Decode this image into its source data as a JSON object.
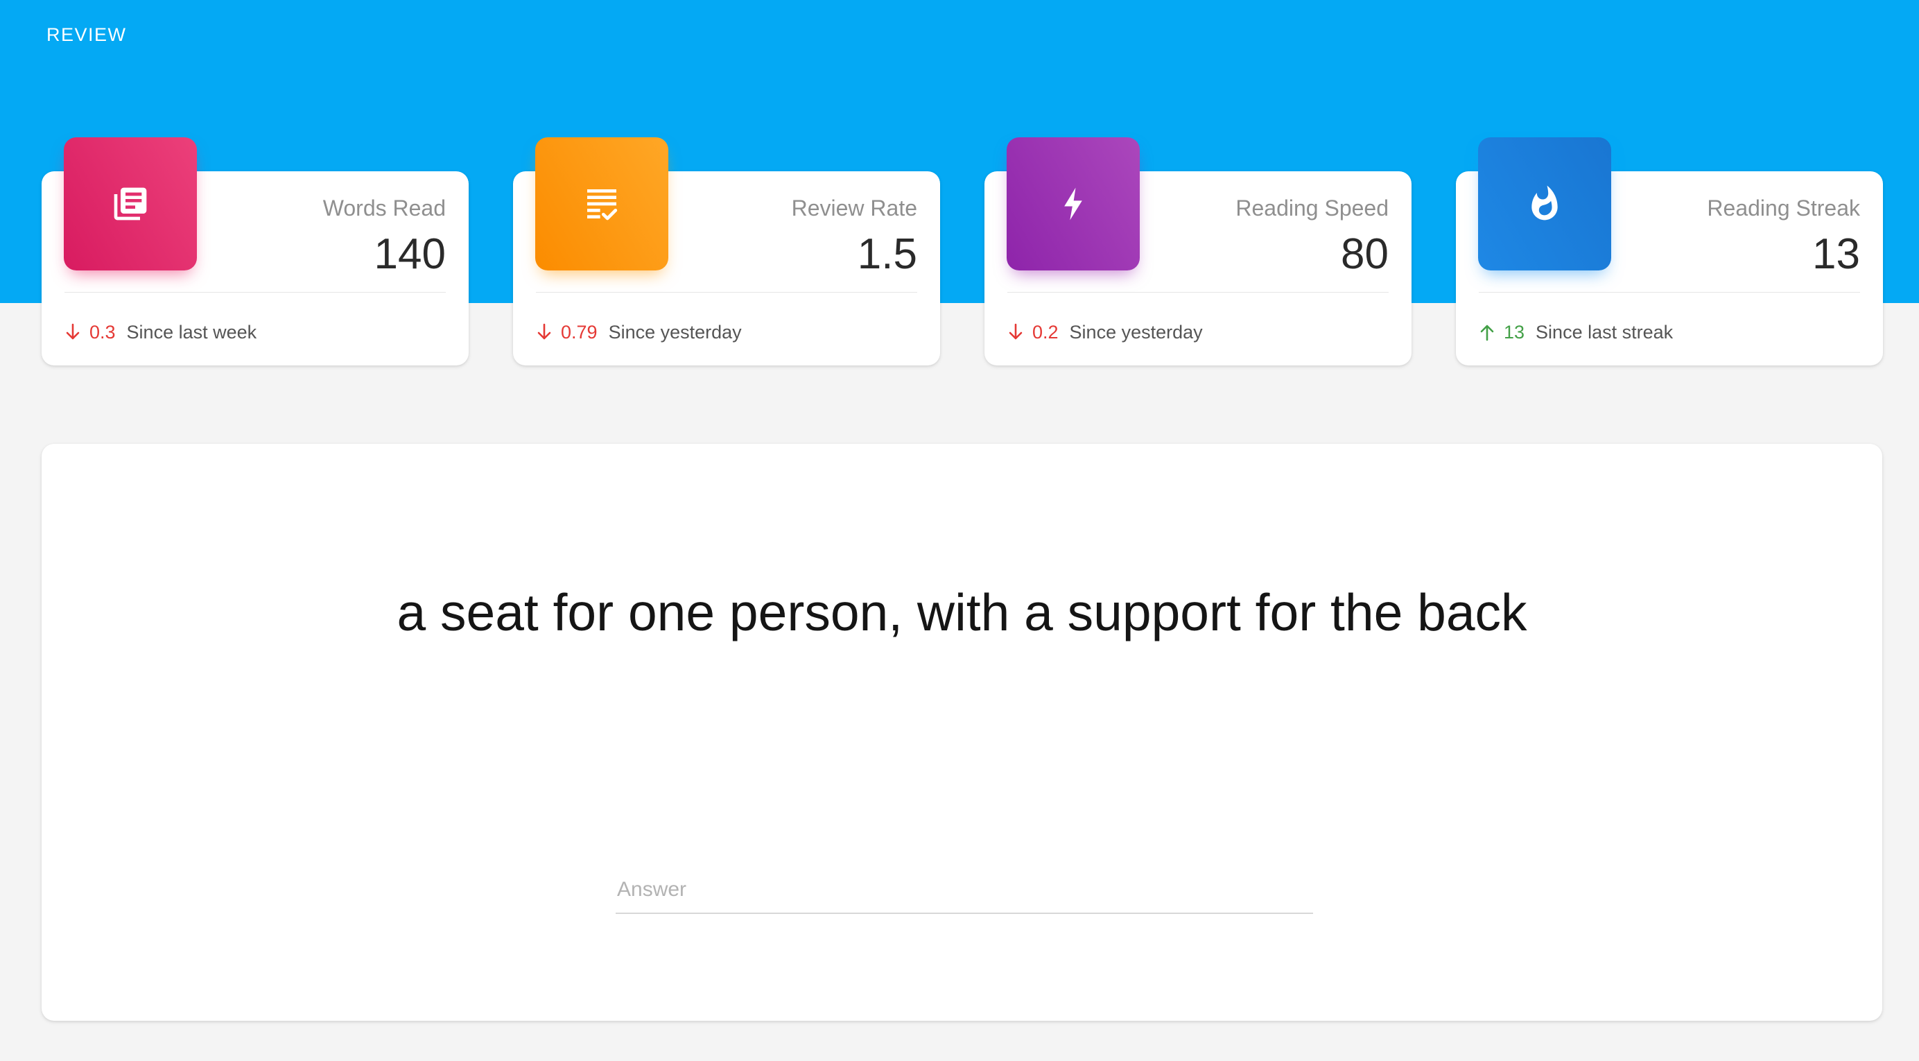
{
  "app": {
    "title": "REVIEW"
  },
  "stats": [
    {
      "label": "Words Read",
      "value": "140",
      "icon": "newspaper-icon",
      "color": "#e91e63",
      "delta": "0.3",
      "delta_direction": "down",
      "delta_text": "Since last week"
    },
    {
      "label": "Review Rate",
      "value": "1.5",
      "icon": "checklist-icon",
      "color": "#ff9800",
      "delta": "0.79",
      "delta_direction": "down",
      "delta_text": "Since yesterday"
    },
    {
      "label": "Reading Speed",
      "value": "80",
      "icon": "lightning-icon",
      "color": "#9c27b0",
      "delta": "0.2",
      "delta_direction": "down",
      "delta_text": "Since yesterday"
    },
    {
      "label": "Reading Streak",
      "value": "13",
      "icon": "flame-icon",
      "color": "#1e88e5",
      "delta": "13",
      "delta_direction": "up",
      "delta_text": "Since last streak"
    }
  ],
  "review": {
    "definition": "a seat for one person, with a support for the back",
    "answer_placeholder": "Answer",
    "answer_value": ""
  },
  "colors": {
    "header_background": "#04a9f4",
    "page_background": "#f4f4f4",
    "delta_down": "#e53935",
    "delta_up": "#43a047"
  }
}
